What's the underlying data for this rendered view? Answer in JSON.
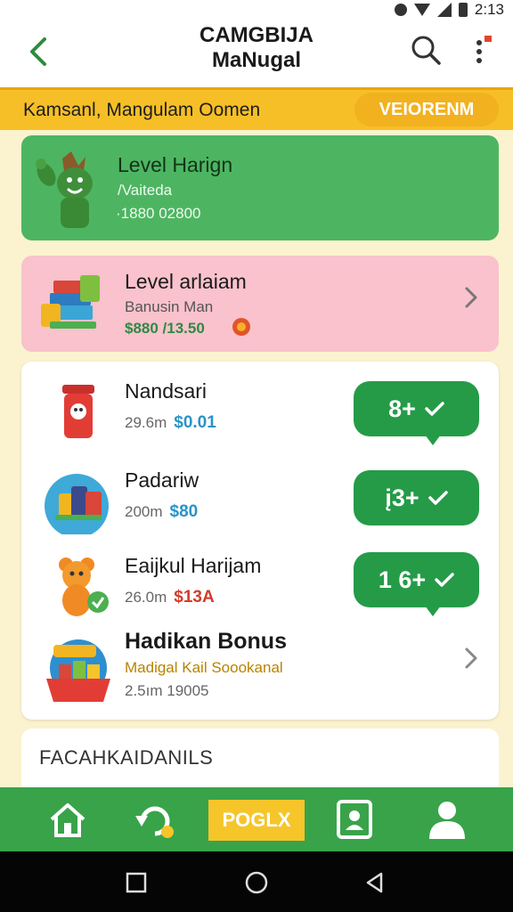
{
  "status_bar": {
    "time": "2:13"
  },
  "app_bar": {
    "title": "CAMGBIJA\nMaNugal"
  },
  "banner": {
    "text": "Kamsanl, Mangulam Oomen",
    "button": "VEIORENM"
  },
  "level_card": {
    "title": "Level Harign",
    "subtitle": "/Vaiteda",
    "value": "·1880 02800"
  },
  "promo_card": {
    "title": "Level  arlaiam",
    "subtitle": "Banusin Man",
    "value": "$880 /13.50"
  },
  "items": [
    {
      "name": "Nandsari",
      "meta": "29.6m",
      "price": "$0.01",
      "price_color": "#2b93c6",
      "badge": "8+"
    },
    {
      "name": "Padariw",
      "meta": "200m",
      "price": "$80",
      "price_color": "#2b93c6",
      "badge": "į3+"
    },
    {
      "name": "Eaijkul Harijam",
      "meta": "26.0m",
      "price": "$13A",
      "price_color": "#d23b2a",
      "badge": "1 6+"
    }
  ],
  "bonus": {
    "title": "Hadikan Bonus",
    "subtitle": "Madigal Kail Soookanal",
    "value": "2.5ım 19005"
  },
  "section": {
    "title": "FACAHKAIDANILS"
  },
  "bottom_nav": {
    "center_label": "POGLX"
  },
  "colors": {
    "green": "#4db561",
    "pink": "#f9c2cc",
    "yellow": "#f6bf27",
    "badge_green": "#259b47",
    "nav_green": "#39a34a"
  }
}
